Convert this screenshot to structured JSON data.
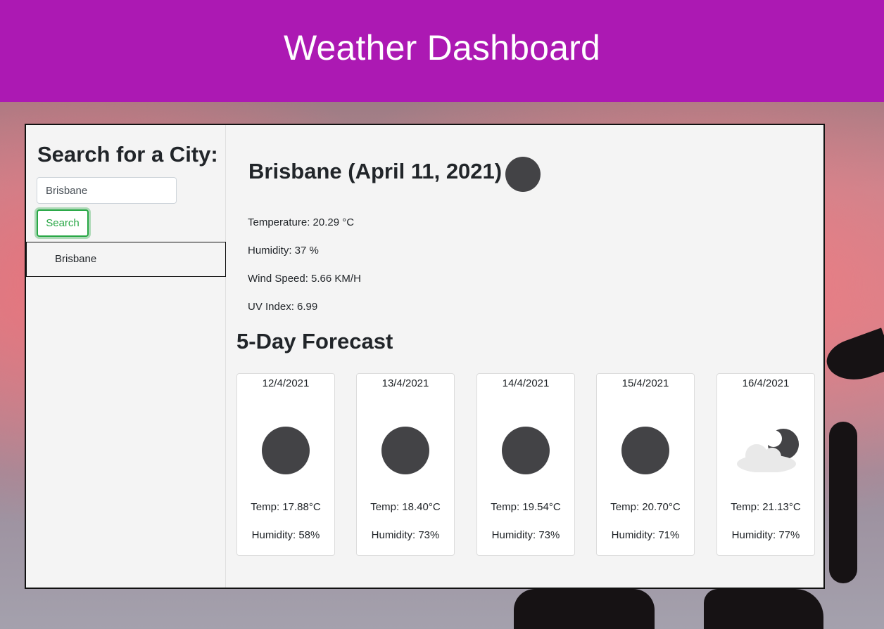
{
  "header": {
    "title": "Weather Dashboard"
  },
  "colors": {
    "header_bg": "#ac19b3",
    "accent_green": "#28a745",
    "weather_icon": "#434346"
  },
  "sidebar": {
    "heading": "Search for a City:",
    "search_input_value": "Brisbane",
    "search_button_label": "Search",
    "history": [
      "Brisbane"
    ]
  },
  "current": {
    "title": "Brisbane (April 11, 2021)",
    "icon": "dark-circle-icon",
    "temperature": "Temperature: 20.29 °C",
    "humidity": "Humidity: 37 %",
    "wind": "Wind Speed: 5.66 KM/H",
    "uv": "UV Index: 6.99"
  },
  "forecast": {
    "heading": "5-Day Forecast",
    "days": [
      {
        "date": "12/4/2021",
        "icon": "dark-circle-icon",
        "temp": "Temp: 17.88°C",
        "humidity": "Humidity: 58%"
      },
      {
        "date": "13/4/2021",
        "icon": "dark-circle-icon",
        "temp": "Temp: 18.40°C",
        "humidity": "Humidity: 73%"
      },
      {
        "date": "14/4/2021",
        "icon": "dark-circle-icon",
        "temp": "Temp: 19.54°C",
        "humidity": "Humidity: 73%"
      },
      {
        "date": "15/4/2021",
        "icon": "dark-circle-icon",
        "temp": "Temp: 20.70°C",
        "humidity": "Humidity: 71%"
      },
      {
        "date": "16/4/2021",
        "icon": "cloud-moon-icon",
        "temp": "Temp: 21.13°C",
        "humidity": "Humidity: 77%"
      }
    ]
  }
}
